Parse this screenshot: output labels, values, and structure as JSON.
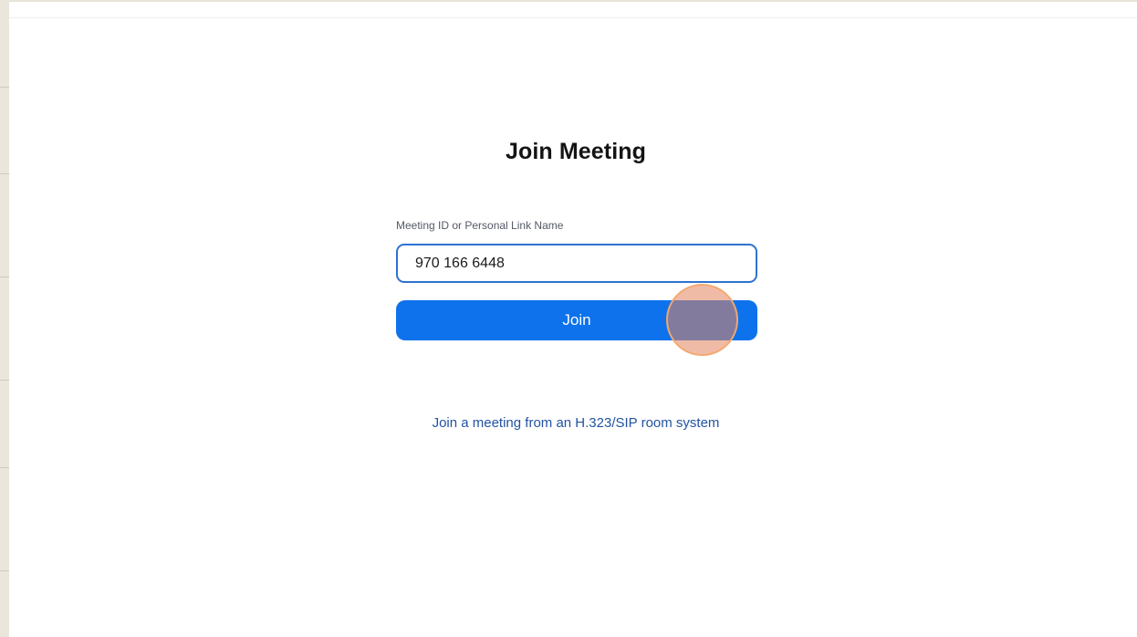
{
  "page": {
    "title": "Join Meeting"
  },
  "join_form": {
    "field_label": "Meeting ID or Personal Link Name",
    "meeting_id_value": "970 166 6448",
    "join_label": "Join"
  },
  "room_system_link": "Join a meeting from an H.323/SIP room system",
  "colors": {
    "primary_button": "#0e72ed",
    "input_focus_border": "#2e72d2",
    "link": "#2253a2",
    "click_marker": "#e4845c"
  }
}
